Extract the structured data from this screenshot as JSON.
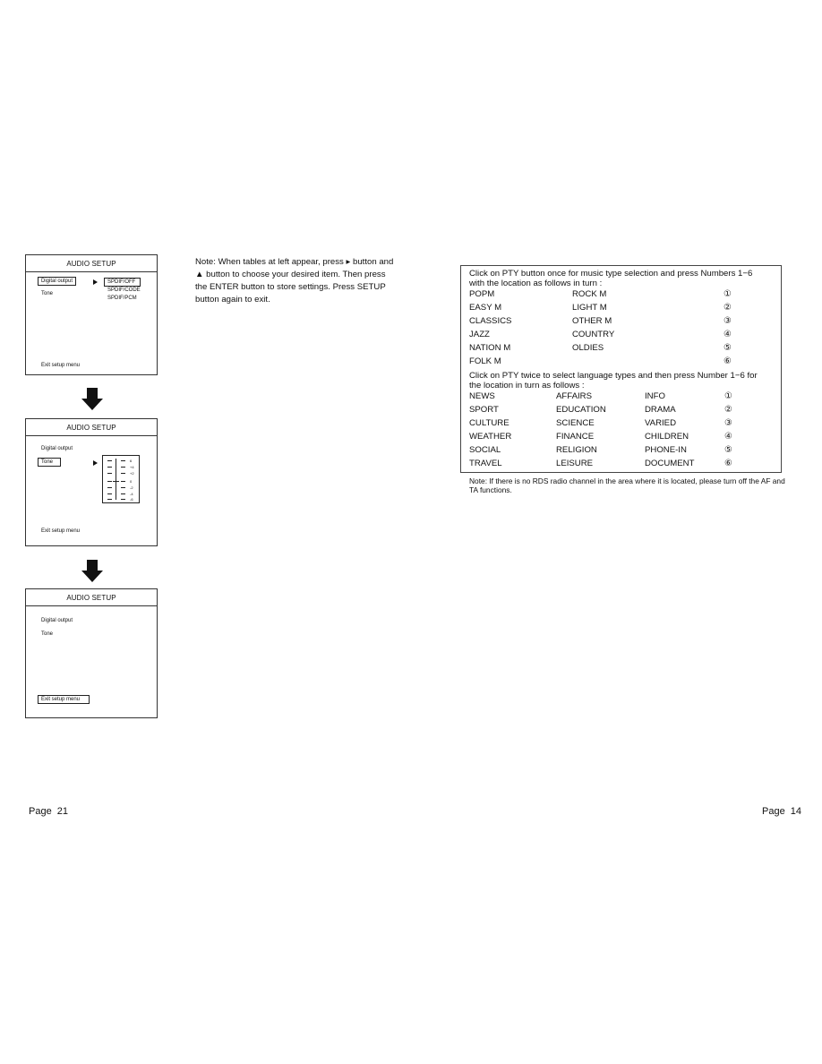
{
  "left_page": {
    "panels": [
      {
        "title": "AUDIO SETUP",
        "items": [
          "Digital output",
          "Tone"
        ],
        "selected": "Digital output",
        "submenu": [
          "SPDIF/OFF",
          "SPDIF/CODE",
          "SPDIF/PCM"
        ],
        "submenu_selected": "SPDIF/OFF",
        "exit": "Exit setup menu"
      },
      {
        "title": "AUDIO SETUP",
        "items": [
          "Digital output",
          "Tone"
        ],
        "selected": "Tone",
        "tone_scale": [
          "6",
          "+4",
          "+2",
          "0",
          "-2",
          "-4",
          "-6"
        ],
        "tone_value": "0",
        "exit": "Exit setup menu"
      },
      {
        "title": "AUDIO SETUP",
        "items": [
          "Digital output",
          "Tone"
        ],
        "selected": "Exit setup menu",
        "exit": "Exit setup menu"
      }
    ],
    "note": "Note: When tables at left appear, press ▸ button and ▲ button to choose your desired item. Then press the ENTER button to store settings. Press SETUP button again to exit.",
    "page_label": "Page  21"
  },
  "right_page": {
    "music_intro": [
      "Click on PTY button once for music type selection and press Numbers 1−6",
      "with  the  location  as  follows  in  turn :"
    ],
    "music_rows": [
      [
        "POPM",
        "ROCK M",
        "①"
      ],
      [
        "EASY M",
        "LIGHT M",
        "②"
      ],
      [
        "CLASSICS",
        "OTHER M",
        "③"
      ],
      [
        "JAZZ",
        "COUNTRY",
        "④"
      ],
      [
        "NATION M",
        "OLDIES",
        "⑤"
      ],
      [
        "FOLK M",
        "",
        "⑥"
      ]
    ],
    "lang_intro": [
      "Click on PTY twice to select language types and then press Number 1−6 for",
      "the location in turn as follows :"
    ],
    "lang_rows": [
      [
        "NEWS",
        "AFFAIRS",
        "INFO",
        "①"
      ],
      [
        "SPORT",
        "EDUCATION",
        "DRAMA",
        "②"
      ],
      [
        "CULTURE",
        "SCIENCE",
        "VARIED",
        "③"
      ],
      [
        "WEATHER",
        "FINANCE",
        "CHILDREN",
        "④"
      ],
      [
        "SOCIAL",
        "RELIGION",
        "PHONE-IN",
        "⑤"
      ],
      [
        "TRAVEL",
        "LEISURE",
        "DOCUMENT",
        "⑥"
      ]
    ],
    "note": "Note: If there is no RDS radio channel in the area where it is located, please turn off the AF and TA functions.",
    "page_label": "Page  14"
  }
}
